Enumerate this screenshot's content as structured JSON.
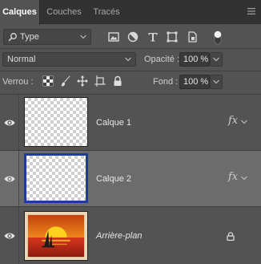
{
  "tabs": [
    {
      "label": "Calques",
      "active": true
    },
    {
      "label": "Couches",
      "active": false
    },
    {
      "label": "Tracés",
      "active": false
    }
  ],
  "filter": {
    "kind_label": "Type",
    "icons": [
      "image-filter-icon",
      "adjustment-filter-icon",
      "text-filter-icon",
      "shape-filter-icon",
      "smart-object-filter-icon",
      "filter-toggle-icon"
    ]
  },
  "blend": {
    "mode": "Normal",
    "opacity_label": "Opacité :",
    "opacity_value": "100 %"
  },
  "lock": {
    "label": "Verrou :",
    "icons": [
      "lock-transparency-icon",
      "lock-image-icon",
      "lock-position-icon",
      "lock-artboard-icon",
      "lock-all-icon"
    ],
    "fill_label": "Fond :",
    "fill_value": "100 %"
  },
  "layers": [
    {
      "name": "Calque 1",
      "visible": true,
      "selected": false,
      "has_fx": true,
      "locked": false
    },
    {
      "name": "Calque 2",
      "visible": true,
      "selected": true,
      "has_fx": true,
      "locked": false
    },
    {
      "name": "Arrière-plan",
      "visible": true,
      "selected": false,
      "has_fx": false,
      "locked": true
    }
  ],
  "colors": {
    "panel": "#535353",
    "tabbar": "#323232",
    "selected_row": "#6c6c6c",
    "selection_border": "#1f3aa0",
    "fx_symbol": "fx"
  }
}
